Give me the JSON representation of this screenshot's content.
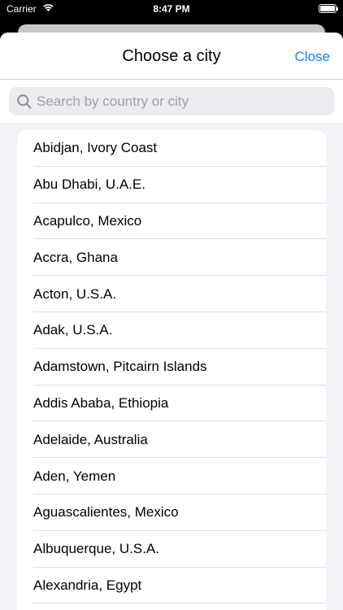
{
  "status_bar": {
    "carrier": "Carrier",
    "time": "8:47 PM"
  },
  "nav": {
    "title": "Choose a city",
    "close_label": "Close"
  },
  "search": {
    "placeholder": "Search by country or city",
    "value": ""
  },
  "cities": [
    "Abidjan, Ivory Coast",
    "Abu Dhabi, U.A.E.",
    "Acapulco, Mexico",
    "Accra, Ghana",
    "Acton, U.S.A.",
    "Adak, U.S.A.",
    "Adamstown, Pitcairn Islands",
    "Addis Ababa, Ethiopia",
    "Adelaide, Australia",
    "Aden, Yemen",
    "Aguascalientes, Mexico",
    "Albuquerque, U.S.A.",
    "Alexandria, Egypt"
  ],
  "colors": {
    "accent": "#0a84ff",
    "sheet_background": "#f2f2f7"
  }
}
